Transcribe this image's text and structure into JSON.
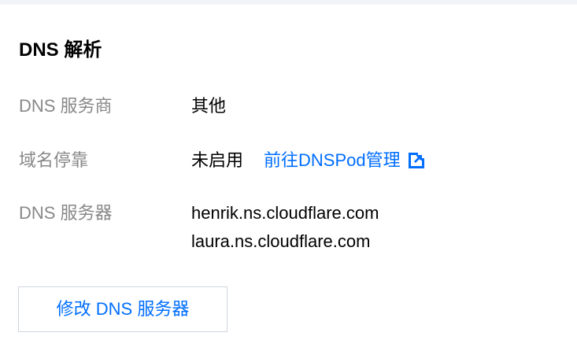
{
  "section": {
    "title": "DNS 解析"
  },
  "rows": {
    "provider": {
      "label": "DNS 服务商",
      "value": "其他"
    },
    "parking": {
      "label": "域名停靠",
      "value": "未启用",
      "link_label": "前往DNSPod管理"
    },
    "servers": {
      "label": "DNS 服务器",
      "values": [
        "henrik.ns.cloudflare.com",
        "laura.ns.cloudflare.com"
      ]
    }
  },
  "actions": {
    "modify_label": "修改 DNS 服务器"
  },
  "icons": {
    "external_link": "external-link-icon"
  },
  "colors": {
    "link": "#006eff",
    "label": "#888888",
    "text": "#000000",
    "button_border": "#cfd5de"
  }
}
